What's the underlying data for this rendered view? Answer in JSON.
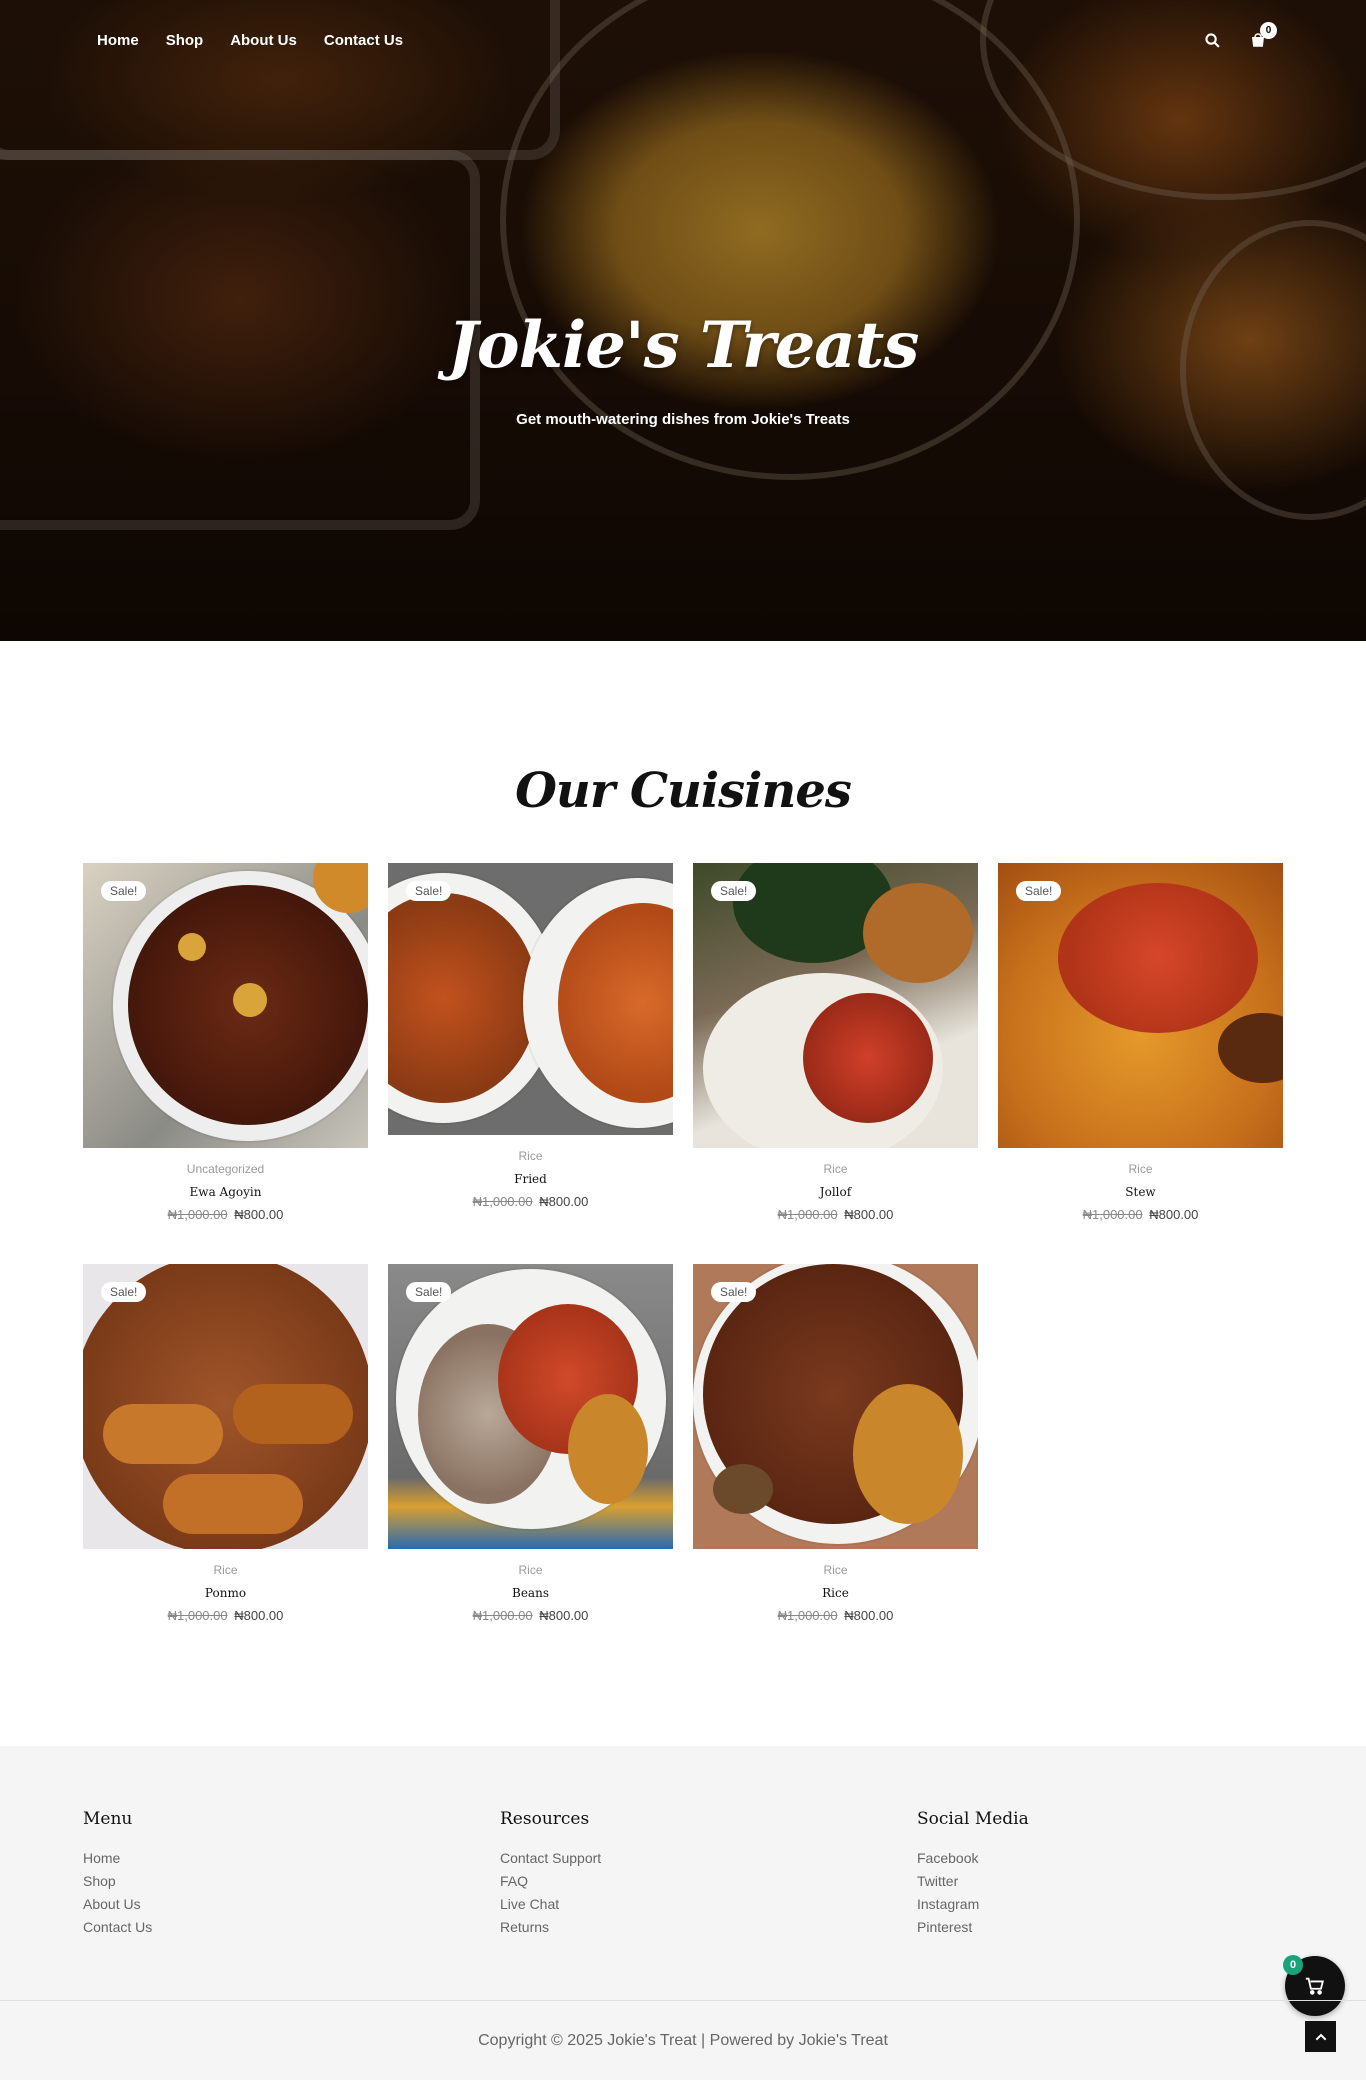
{
  "nav": {
    "links": [
      "Home",
      "Shop",
      "About Us",
      "Contact Us"
    ],
    "cart_count": "0"
  },
  "hero": {
    "title": "Jokie's Treats",
    "subtitle": "Get mouth-watering dishes from Jokie's Treats"
  },
  "cuisines": {
    "title": "Our Cuisines",
    "sale_label": "Sale!",
    "products": [
      {
        "category": "Uncategorized",
        "name": "Ewa Agoyin",
        "old_price": "₦1,000.00",
        "price": "₦800.00"
      },
      {
        "category": "Rice",
        "name": "Fried",
        "old_price": "₦1,000.00",
        "price": "₦800.00"
      },
      {
        "category": "Rice",
        "name": "Jollof",
        "old_price": "₦1,000.00",
        "price": "₦800.00"
      },
      {
        "category": "Rice",
        "name": "Stew",
        "old_price": "₦1,000.00",
        "price": "₦800.00"
      },
      {
        "category": "Rice",
        "name": "Ponmo",
        "old_price": "₦1,000.00",
        "price": "₦800.00"
      },
      {
        "category": "Rice",
        "name": "Beans",
        "old_price": "₦1,000.00",
        "price": "₦800.00"
      },
      {
        "category": "Rice",
        "name": "Rice",
        "old_price": "₦1,000.00",
        "price": "₦800.00"
      }
    ]
  },
  "footer": {
    "menu": {
      "title": "Menu",
      "links": [
        "Home",
        "Shop",
        "About Us",
        "Contact Us"
      ]
    },
    "resources": {
      "title": "Resources",
      "links": [
        "Contact Support",
        "FAQ",
        "Live Chat",
        "Returns"
      ]
    },
    "social": {
      "title": "Social Media",
      "links": [
        "Facebook",
        "Twitter",
        "Instagram",
        "Pinterest"
      ]
    },
    "copyright": "Copyright © 2025 Jokie's Treat | Powered by Jokie's Treat",
    "floating_cart_count": "0"
  },
  "colors": {
    "accent_badge": "#1aa37a",
    "footer_bg": "#f5f5f5"
  }
}
